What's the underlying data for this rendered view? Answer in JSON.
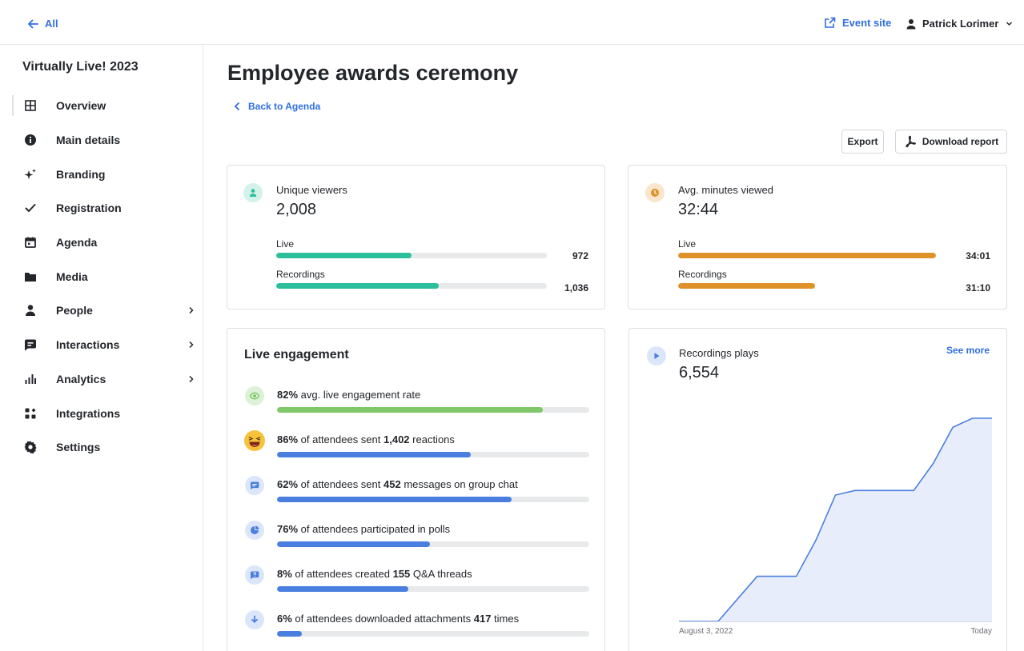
{
  "colors": {
    "accent": "#2f6fe0",
    "teal": "#2bbf9c",
    "orange": "#e0922a",
    "green": "#7ec86a",
    "blue": "#4a7fe0"
  },
  "topbar": {
    "back_label": "All",
    "event_site_label": "Event site",
    "user_name": "Patrick Lorimer"
  },
  "sidebar": {
    "title": "Virtually Live! 2023",
    "items": [
      {
        "label": "Overview",
        "icon": "grid-icon"
      },
      {
        "label": "Main details",
        "icon": "info-icon"
      },
      {
        "label": "Branding",
        "icon": "sparkle-icon"
      },
      {
        "label": "Registration",
        "icon": "check-icon"
      },
      {
        "label": "Agenda",
        "icon": "calendar-icon"
      },
      {
        "label": "Media",
        "icon": "folder-icon"
      },
      {
        "label": "People",
        "icon": "person-icon",
        "has_submenu": true
      },
      {
        "label": "Interactions",
        "icon": "chat-icon",
        "has_submenu": true
      },
      {
        "label": "Analytics",
        "icon": "bar-chart-icon",
        "has_submenu": true
      },
      {
        "label": "Integrations",
        "icon": "integrations-icon"
      },
      {
        "label": "Settings",
        "icon": "gear-icon"
      }
    ]
  },
  "main": {
    "title": "Employee awards ceremony",
    "back_to_agenda": "Back to Agenda",
    "export_label": "Export",
    "download_label": "Download report",
    "unique_viewers": {
      "label": "Unique viewers",
      "value": "2,008",
      "live_label": "Live",
      "live_value": "972",
      "live_fraction": 0.5,
      "recordings_label": "Recordings",
      "recordings_value": "1,036",
      "recordings_fraction": 0.6
    },
    "avg_minutes": {
      "label": "Avg. minutes viewed",
      "value": "32:44",
      "live_label": "Live",
      "live_value": "34:01",
      "live_fraction": 1.0,
      "recordings_label": "Recordings",
      "recordings_value": "31:10",
      "recordings_fraction": 0.53
    },
    "live_engagement": {
      "title": "Live engagement",
      "rows": [
        {
          "pct": "82%",
          "text": " avg. live engagement rate",
          "fraction": 0.85,
          "icon": "eye-icon"
        },
        {
          "pct": "86%",
          "text": " of attendees sent ",
          "count": "1,402",
          "tail": " reactions",
          "fraction": 0.62,
          "icon": "laughing-emoji-icon"
        },
        {
          "pct": "62%",
          "text": " of attendees sent ",
          "count": "452",
          "tail": " messages on group chat",
          "fraction": 0.75,
          "icon": "message-icon"
        },
        {
          "pct": "76%",
          "text": " of attendees participated in polls",
          "fraction": 0.49,
          "icon": "poll-icon"
        },
        {
          "pct": "8%",
          "text": " of attendees created ",
          "count": "155",
          "tail": " Q&A threads",
          "fraction": 0.42,
          "icon": "question-icon"
        },
        {
          "pct": "6%",
          "text": " of attendees downloaded attachments ",
          "count": "417",
          "tail": " times",
          "fraction": 0.08,
          "icon": "download-icon"
        }
      ]
    },
    "recordings_plays": {
      "label": "Recordings plays",
      "value": "6,554",
      "see_more": "See more",
      "x_start": "August 3, 2022",
      "x_end": "Today"
    }
  },
  "chart_data": {
    "type": "area",
    "title": "Recordings plays",
    "xlabel": "",
    "ylabel": "",
    "x": [
      "August 3, 2022",
      "",
      "",
      "",
      "",
      "",
      "",
      "",
      "",
      "",
      "",
      "",
      "",
      "",
      "",
      "",
      "Today"
    ],
    "series": [
      {
        "values": [
          0,
          0,
          0,
          0.5,
          1,
          1,
          1,
          1.8,
          2.8,
          2.9,
          2.9,
          2.9,
          2.9,
          3.5,
          4.3,
          4.5,
          4.5
        ]
      }
    ],
    "grid": false,
    "legend": "none"
  }
}
